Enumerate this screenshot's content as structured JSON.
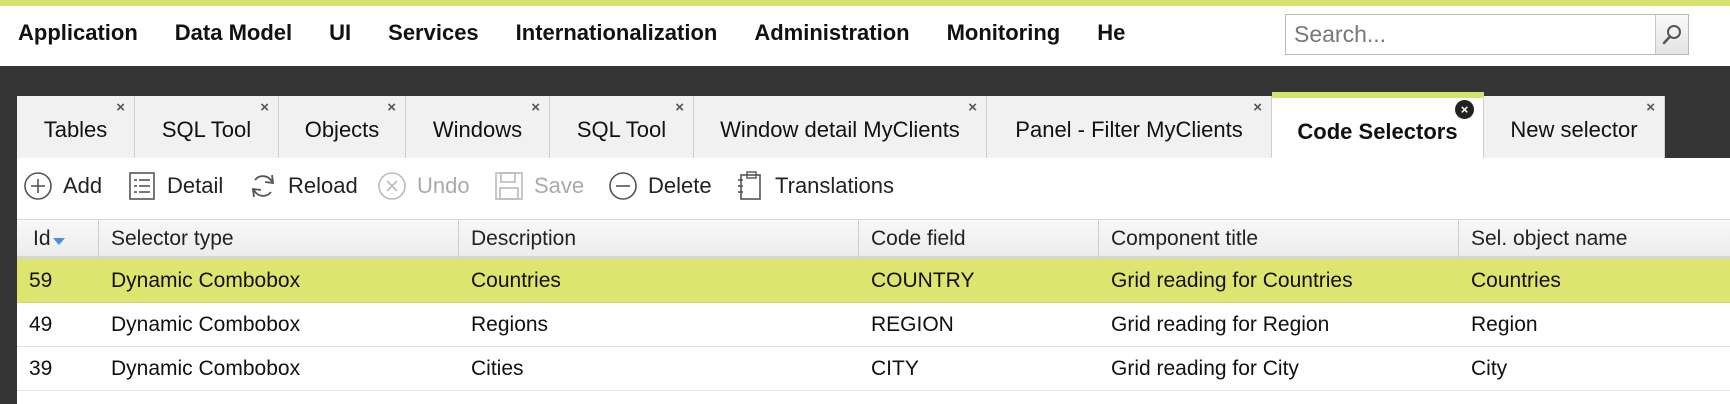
{
  "menu": {
    "items": [
      "Application",
      "Data Model",
      "UI",
      "Services",
      "Internationalization",
      "Administration",
      "Monitoring",
      "He"
    ],
    "search_placeholder": "Search..."
  },
  "tabs": [
    {
      "label": "Tables",
      "active": false
    },
    {
      "label": "SQL Tool",
      "active": false
    },
    {
      "label": "Objects",
      "active": false
    },
    {
      "label": "Windows",
      "active": false
    },
    {
      "label": "SQL Tool",
      "active": false
    },
    {
      "label": "Window detail MyClients",
      "active": false
    },
    {
      "label": "Panel - Filter MyClients",
      "active": false
    },
    {
      "label": "Code Selectors",
      "active": true
    },
    {
      "label": "New selector",
      "active": false
    }
  ],
  "tab_close_glyph": "×",
  "toolbar": {
    "add": "Add",
    "detail": "Detail",
    "reload": "Reload",
    "undo": "Undo",
    "save": "Save",
    "delete": "Delete",
    "translations": "Translations"
  },
  "grid": {
    "columns": [
      "Id",
      "Selector type",
      "Description",
      "Code field",
      "Component title",
      "Sel. object name"
    ],
    "sort_column": "Id",
    "sort_direction": "descending",
    "rows": [
      {
        "cells": [
          "59",
          "Dynamic Combobox",
          "Countries",
          "COUNTRY",
          "Grid reading for Countries",
          "Countries"
        ],
        "selected": true
      },
      {
        "cells": [
          "49",
          "Dynamic Combobox",
          "Regions",
          "REGION",
          "Grid reading for Region",
          "Region"
        ],
        "selected": false
      },
      {
        "cells": [
          "39",
          "Dynamic Combobox",
          "Cities",
          "CITY",
          "Grid reading for City",
          "City"
        ],
        "selected": false
      }
    ]
  },
  "colors": {
    "accent": "#d5e26f",
    "selected_row": "#dde46f",
    "dark_background": "#353535"
  }
}
